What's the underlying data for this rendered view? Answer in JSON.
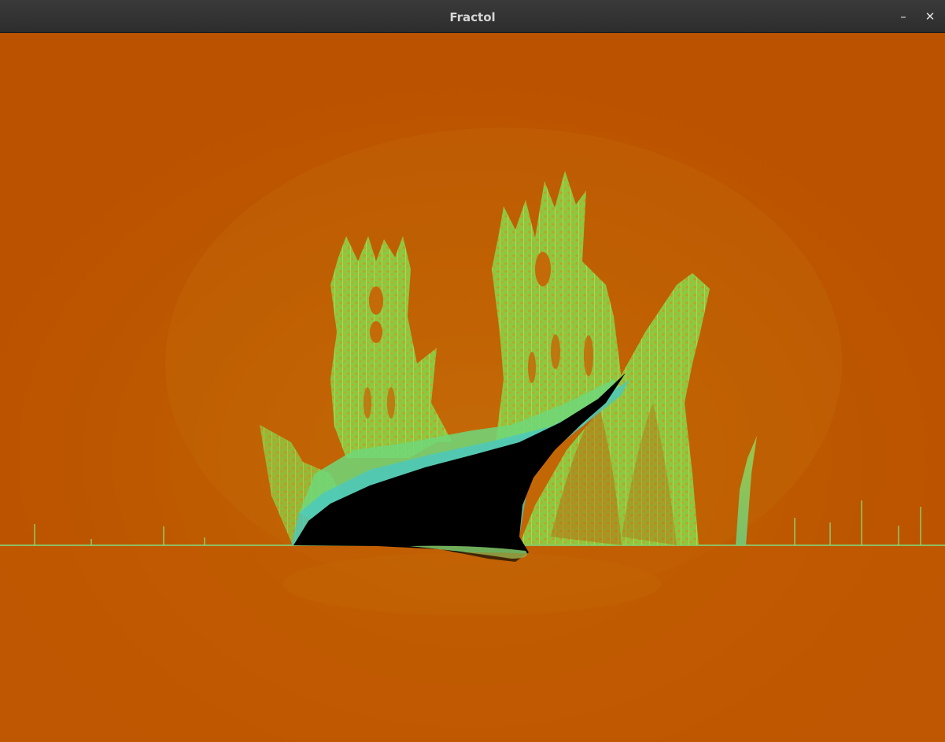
{
  "window": {
    "title": "Fractol",
    "minimize_label": "–",
    "close_label": "✕"
  },
  "fractal": {
    "background_color": "#bb5200",
    "glow_color": "#c8700a",
    "set_color": "#000000",
    "edge_color_outer": "#7fd268",
    "edge_color_inner": "#46c8c8"
  }
}
